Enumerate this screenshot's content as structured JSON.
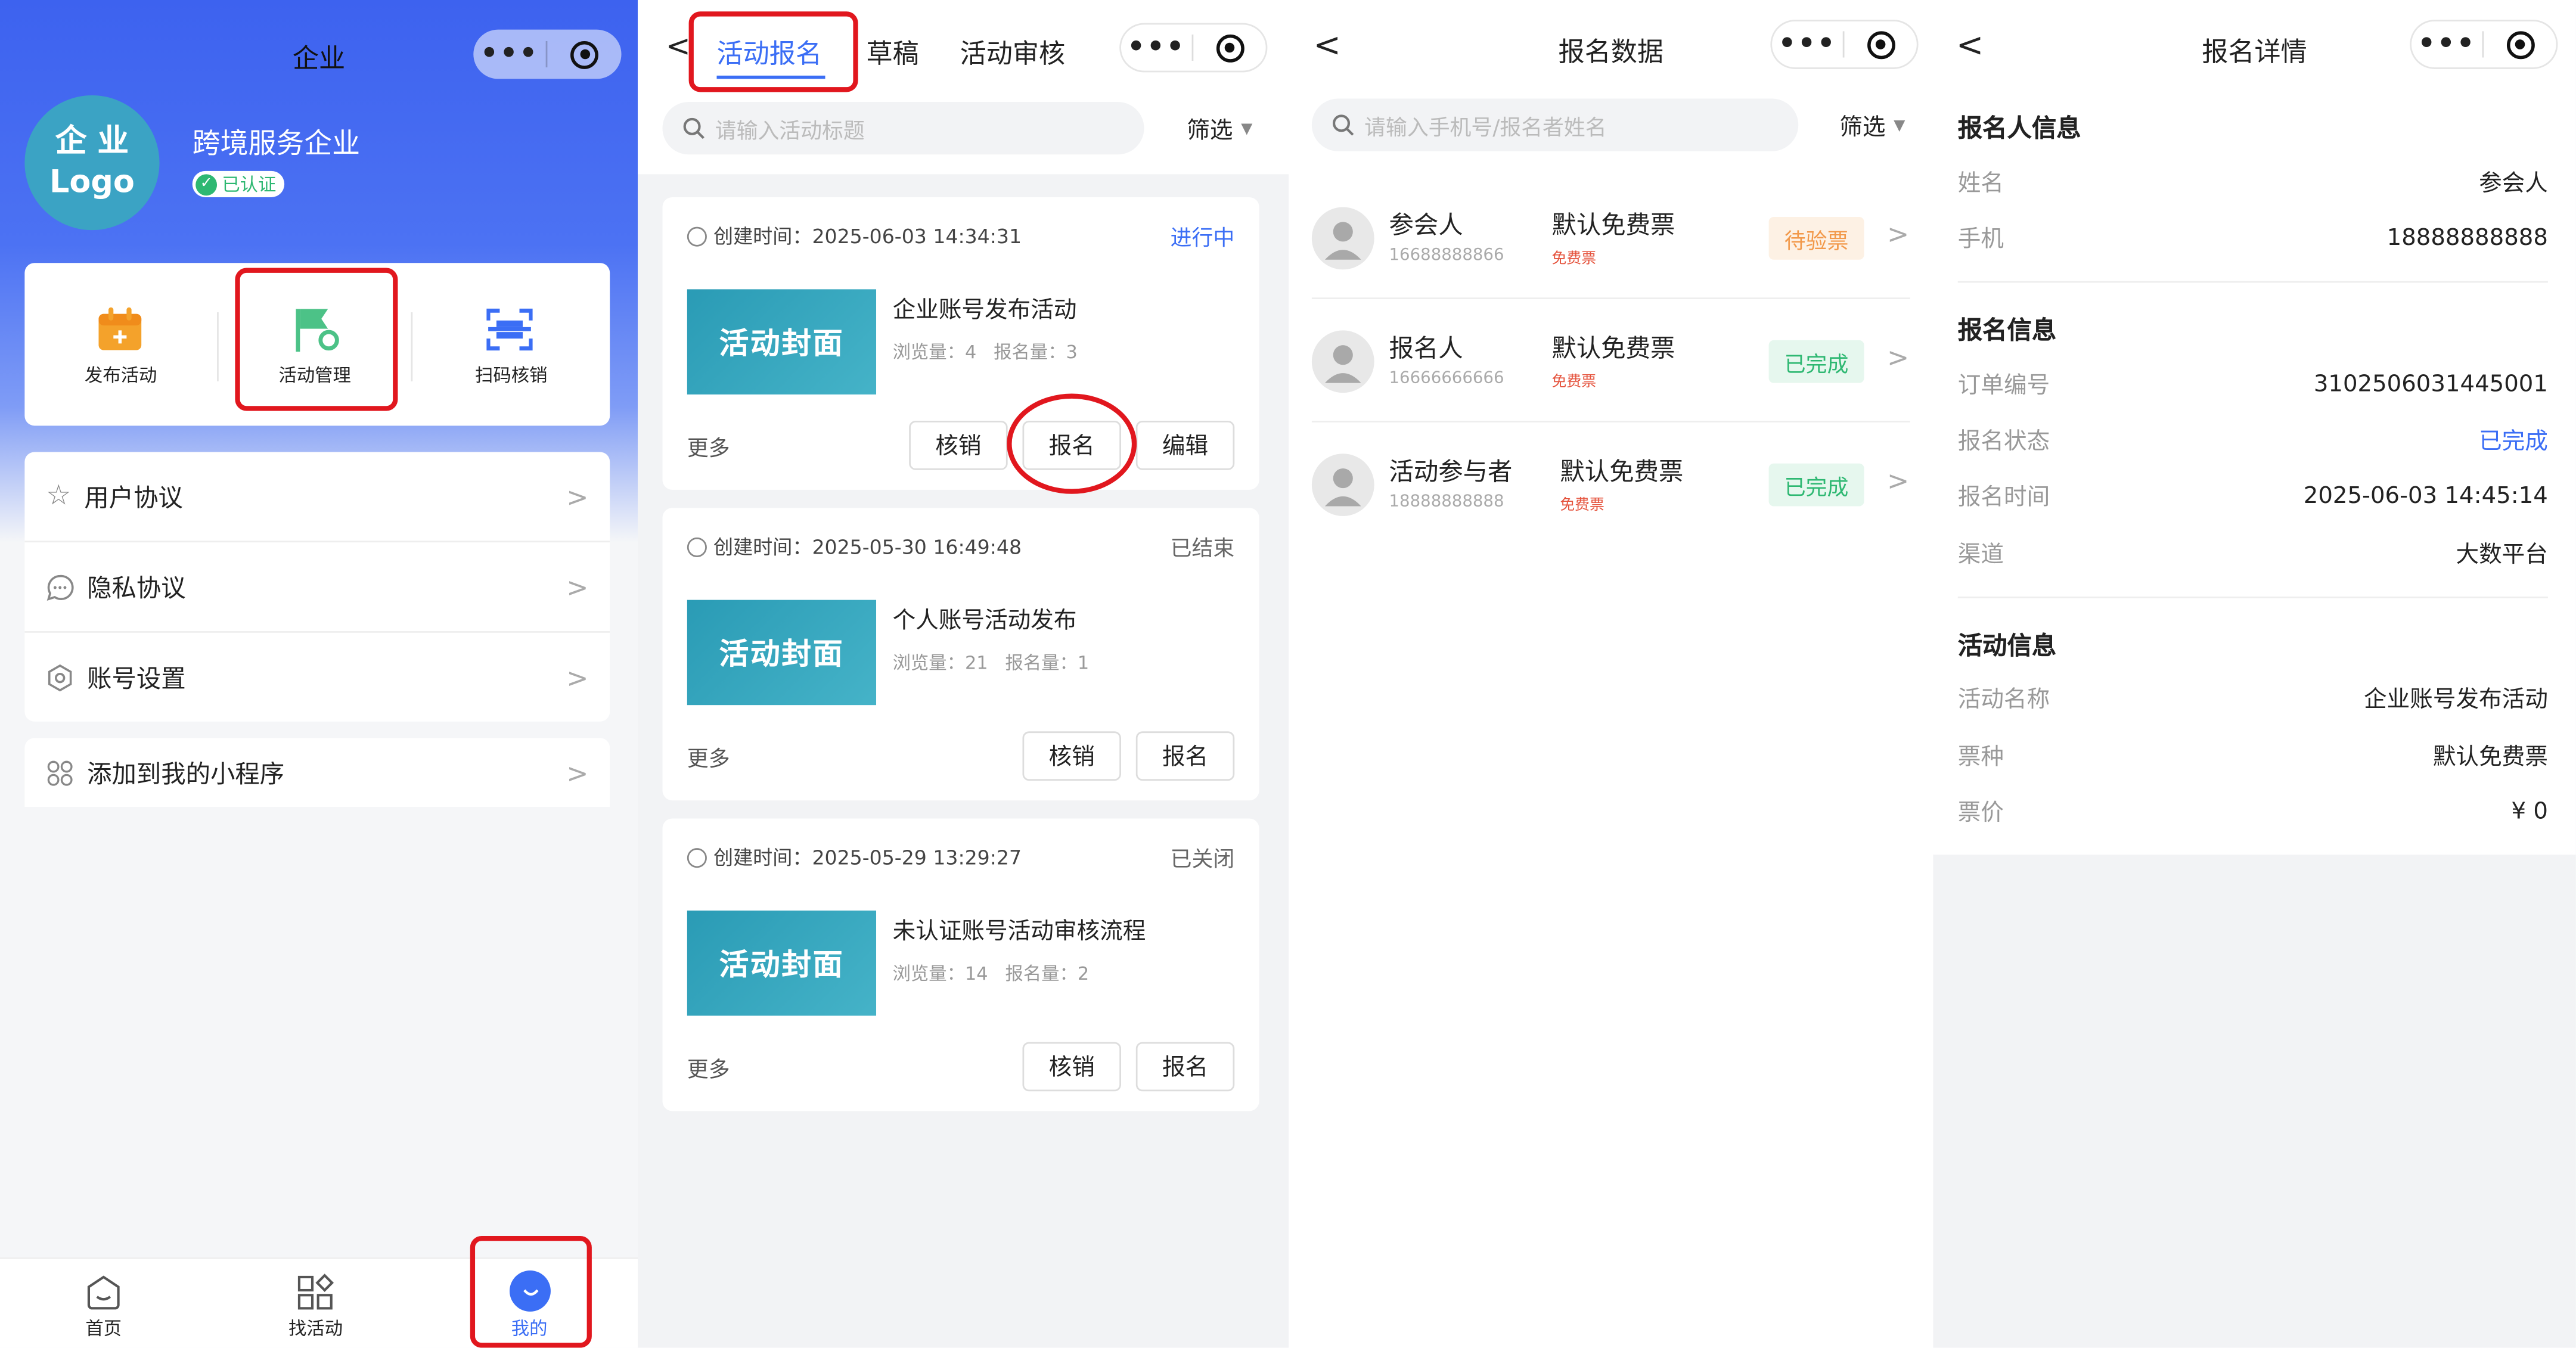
{
  "panel1": {
    "nav_title": "企业",
    "logo_line1": "企 业",
    "logo_line2": "Logo",
    "company_name": "跨境服务企业",
    "verified_badge": "已认证",
    "quick_actions": [
      {
        "label": "发布活动",
        "icon": "calendar-add-icon"
      },
      {
        "label": "活动管理",
        "icon": "flag-gear-icon"
      },
      {
        "label": "扫码核销",
        "icon": "scan-icon"
      }
    ],
    "menu": [
      {
        "label": "用户协议",
        "icon": "star-icon"
      },
      {
        "label": "隐私协议",
        "icon": "chat-bubble-icon"
      },
      {
        "label": "账号设置",
        "icon": "gear-icon"
      }
    ],
    "add_miniprogram": "添加到我的小程序",
    "tabbar": [
      {
        "label": "首页",
        "icon": "home-icon"
      },
      {
        "label": "找活动",
        "icon": "grid-icon"
      },
      {
        "label": "我的",
        "icon": "smile-icon"
      }
    ]
  },
  "panel2": {
    "tabs": [
      "活动报名",
      "草稿",
      "活动审核"
    ],
    "search_placeholder": "请输入活动标题",
    "filter_label": "筛选",
    "cards": [
      {
        "created_label": "创建时间：",
        "created": "2025-06-03 14:34:31",
        "status": "进行中",
        "status_color": "#3b6ef5",
        "cover": "活动封面",
        "title": "企业账号发布活动",
        "stats": "浏览量：4   报名量：3",
        "more": "更多",
        "buttons": [
          "核销",
          "报名",
          "编辑"
        ]
      },
      {
        "created_label": "创建时间：",
        "created": "2025-05-30 16:49:48",
        "status": "已结束",
        "status_color": "#666666",
        "cover": "活动封面",
        "title": "个人账号活动发布",
        "stats": "浏览量：21   报名量：1",
        "more": "更多",
        "buttons": [
          "核销",
          "报名"
        ]
      },
      {
        "created_label": "创建时间：",
        "created": "2025-05-29 13:29:27",
        "status": "已关闭",
        "status_color": "#666666",
        "cover": "活动封面",
        "title": "未认证账号活动审核流程",
        "stats": "浏览量：14   报名量：2",
        "more": "更多",
        "buttons": [
          "核销",
          "报名"
        ]
      }
    ]
  },
  "panel3": {
    "title": "报名数据",
    "search_placeholder": "请输入手机号/报名者姓名",
    "filter_label": "筛选",
    "rows": [
      {
        "name": "参会人",
        "phone": "16688888866",
        "ticket": "默认免费票",
        "ticket_type": "免费票",
        "status": "待验票",
        "status_kind": "pending"
      },
      {
        "name": "报名人",
        "phone": "16666666666",
        "ticket": "默认免费票",
        "ticket_type": "免费票",
        "status": "已完成",
        "status_kind": "done"
      },
      {
        "name": "活动参与者",
        "phone": "18888888888",
        "ticket": "默认免费票",
        "ticket_type": "免费票",
        "status": "已完成",
        "status_kind": "done"
      }
    ]
  },
  "panel4": {
    "title": "报名详情",
    "section_registrant": "报名人信息",
    "registrant": [
      {
        "key": "姓名",
        "value": "参会人"
      },
      {
        "key": "手机",
        "value": "18888888888"
      }
    ],
    "section_registration": "报名信息",
    "registration": [
      {
        "key": "订单编号",
        "value": "3102506031445001"
      },
      {
        "key": "报名状态",
        "value": "已完成"
      },
      {
        "key": "报名时间",
        "value": "2025-06-03 14:45:14"
      },
      {
        "key": "渠道",
        "value": "大数平台"
      }
    ],
    "section_activity": "活动信息",
    "activity": [
      {
        "key": "活动名称",
        "value": "企业账号发布活动"
      },
      {
        "key": "票种",
        "value": "默认免费票"
      },
      {
        "key": "票价",
        "value": "¥ 0"
      }
    ]
  },
  "colors": {
    "primary_blue": "#3b6ef5",
    "highlight_red": "#e1171e",
    "pending_orange": "#f2994a",
    "done_green": "#2eb872",
    "ticket_red": "#e5533d"
  }
}
